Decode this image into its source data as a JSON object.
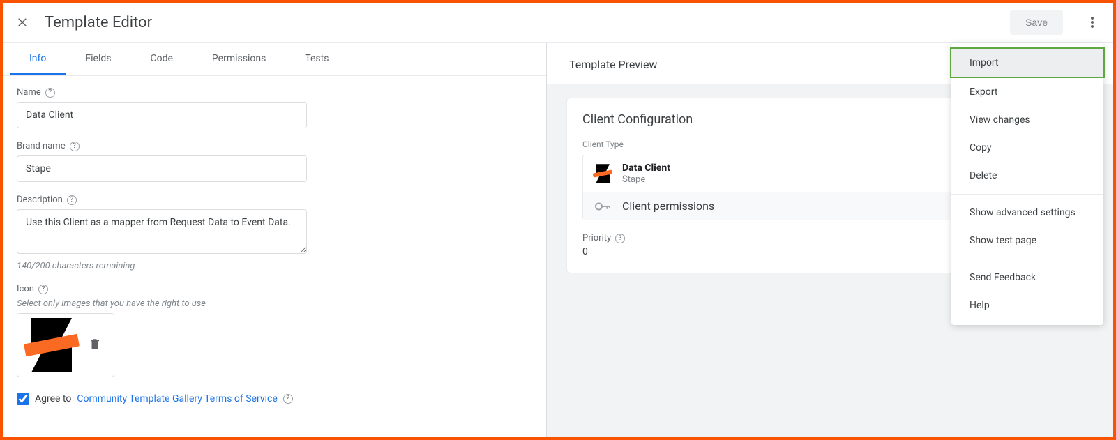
{
  "header": {
    "title": "Template Editor",
    "save_label": "Save"
  },
  "tabs": [
    "Info",
    "Fields",
    "Code",
    "Permissions",
    "Tests"
  ],
  "form": {
    "name_label": "Name",
    "name_value": "Data Client",
    "brand_label": "Brand name",
    "brand_value": "Stape",
    "desc_label": "Description",
    "desc_value": "Use this Client as a mapper from Request Data to Event Data.",
    "desc_hint": "140/200 characters remaining",
    "icon_label": "Icon",
    "icon_hint": "Select only images that you have the right to use",
    "agree_prefix": "Agree to ",
    "agree_link": "Community Template Gallery Terms of Service",
    "agree_checked": true,
    "template_icon": "stape-bowtie-icon"
  },
  "preview": {
    "title": "Template Preview",
    "card_title": "Client Configuration",
    "client_type_label": "Client Type",
    "client_name": "Data Client",
    "client_brand": "Stape",
    "permissions_label": "Client permissions",
    "priority_label": "Priority",
    "priority_value": "0"
  },
  "menu": {
    "items_top": [
      "Import",
      "Export",
      "View changes",
      "Copy",
      "Delete"
    ],
    "items_mid": [
      "Show advanced settings",
      "Show test page"
    ],
    "items_bot": [
      "Send Feedback",
      "Help"
    ],
    "highlighted_index": 0
  }
}
